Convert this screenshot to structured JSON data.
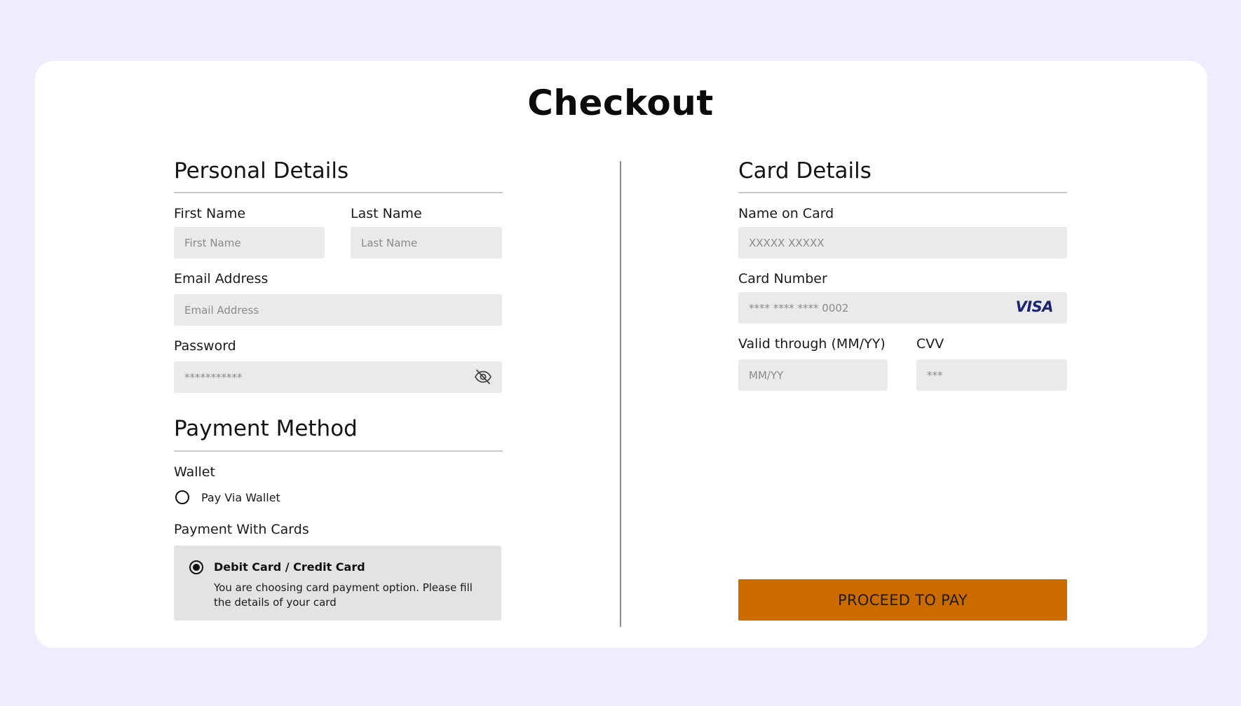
{
  "page": {
    "title": "Checkout"
  },
  "personal": {
    "title": "Personal Details",
    "first_name": {
      "label": "First Name",
      "placeholder": "First Name"
    },
    "last_name": {
      "label": "Last Name",
      "placeholder": "Last Name"
    },
    "email": {
      "label": "Email Address",
      "placeholder": "Email Address"
    },
    "password": {
      "label": "Password",
      "placeholder": "***********",
      "toggle_icon": "eye-off-icon"
    }
  },
  "payment": {
    "title": "Payment Method",
    "wallet_label": "Wallet",
    "wallet_option": "Pay Via Wallet",
    "wallet_selected": false,
    "cards_label": "Payment With Cards",
    "card_option_title": "Debit Card / Credit Card",
    "card_option_desc": "You are choosing card payment option. Please fill the details of your card",
    "card_selected": true
  },
  "card": {
    "title": "Card Details",
    "name_on_card": {
      "label": "Name on Card",
      "placeholder": "XXXXX XXXXX"
    },
    "card_number": {
      "label": "Card Number",
      "placeholder": "**** **** **** 0002",
      "brand": "VISA"
    },
    "valid_through": {
      "label": "Valid through (MM/YY)",
      "placeholder": "MM/YY"
    },
    "cvv": {
      "label": "CVV",
      "placeholder": "***"
    }
  },
  "actions": {
    "proceed_label": "PROCEED TO PAY"
  },
  "colors": {
    "background": "#efecfe",
    "field": "#eaeaea",
    "button": "#cc6c00",
    "visa": "#1a2470"
  }
}
